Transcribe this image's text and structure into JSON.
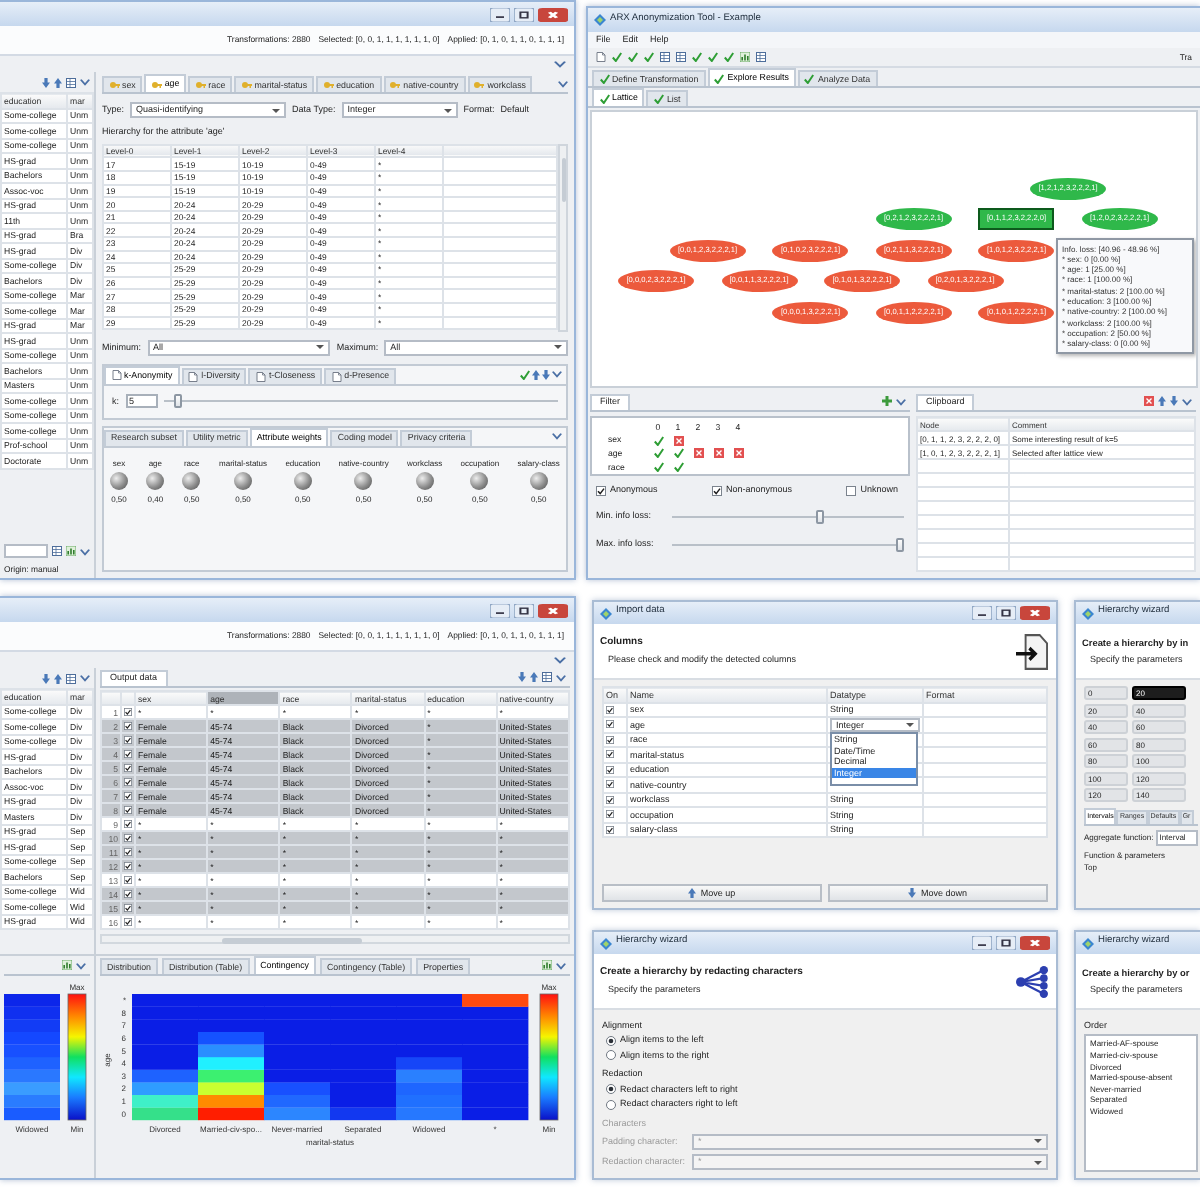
{
  "config_window": {
    "info": [
      "Transformations: 2880",
      "Selected: [0, 0, 1, 1, 1, 1, 1, 1, 0]",
      "Applied: [0, 1, 0, 1, 1, 0, 1, 1, 1]"
    ],
    "input_table": {
      "columns": [
        "education",
        "mar"
      ],
      "rows": [
        [
          "Some-college",
          "Unm"
        ],
        [
          "Some-college",
          "Unm"
        ],
        [
          "Some-college",
          "Unm"
        ],
        [
          "HS-grad",
          "Unm"
        ],
        [
          "Bachelors",
          "Unm"
        ],
        [
          "Assoc-voc",
          "Unm"
        ],
        [
          "HS-grad",
          "Unm"
        ],
        [
          "11th",
          "Unm"
        ],
        [
          "HS-grad",
          "Bra"
        ],
        [
          "HS-grad",
          "Div"
        ],
        [
          "Some-college",
          "Div"
        ],
        [
          "Bachelors",
          "Div"
        ],
        [
          "Some-college",
          "Mar"
        ],
        [
          "Some-college",
          "Mar"
        ],
        [
          "HS-grad",
          "Mar"
        ],
        [
          "HS-grad",
          "Unm"
        ],
        [
          "Some-college",
          "Unm"
        ],
        [
          "Bachelors",
          "Unm"
        ],
        [
          "Masters",
          "Unm"
        ],
        [
          "Some-college",
          "Unm"
        ],
        [
          "Some-college",
          "Unm"
        ],
        [
          "Some-college",
          "Unm"
        ],
        [
          "Prof-school",
          "Unm"
        ],
        [
          "Doctorate",
          "Unm"
        ]
      ]
    },
    "origin": "Origin: manual",
    "attribute_tabs": [
      {
        "label": "sex",
        "selected": false
      },
      {
        "label": "age",
        "selected": true
      },
      {
        "label": "race",
        "selected": false
      },
      {
        "label": "marital-status",
        "selected": false
      },
      {
        "label": "education",
        "selected": false
      },
      {
        "label": "native-country",
        "selected": false
      },
      {
        "label": "workclass",
        "selected": false
      }
    ],
    "type": {
      "label": "Type:",
      "value": "Quasi-identifying"
    },
    "data_type": {
      "label": "Data Type:",
      "value": "Integer"
    },
    "format": {
      "label": "Format:",
      "value": "Default"
    },
    "hierarchy_caption": "Hierarchy for the attribute 'age'",
    "hierarchy": {
      "columns": [
        "Level-0",
        "Level-1",
        "Level-2",
        "Level-3",
        "Level-4"
      ],
      "rows": [
        [
          "17",
          "15-19",
          "10-19",
          "0-49",
          "*"
        ],
        [
          "18",
          "15-19",
          "10-19",
          "0-49",
          "*"
        ],
        [
          "19",
          "15-19",
          "10-19",
          "0-49",
          "*"
        ],
        [
          "20",
          "20-24",
          "20-29",
          "0-49",
          "*"
        ],
        [
          "21",
          "20-24",
          "20-29",
          "0-49",
          "*"
        ],
        [
          "22",
          "20-24",
          "20-29",
          "0-49",
          "*"
        ],
        [
          "23",
          "20-24",
          "20-29",
          "0-49",
          "*"
        ],
        [
          "24",
          "20-24",
          "20-29",
          "0-49",
          "*"
        ],
        [
          "25",
          "25-29",
          "20-29",
          "0-49",
          "*"
        ],
        [
          "26",
          "25-29",
          "20-29",
          "0-49",
          "*"
        ],
        [
          "27",
          "25-29",
          "20-29",
          "0-49",
          "*"
        ],
        [
          "28",
          "25-29",
          "20-29",
          "0-49",
          "*"
        ],
        [
          "29",
          "25-29",
          "20-29",
          "0-49",
          "*"
        ]
      ]
    },
    "minimum": {
      "label": "Minimum:",
      "value": "All"
    },
    "maximum": {
      "label": "Maximum:",
      "value": "All"
    },
    "criteria_tabs": [
      {
        "label": "k-Anonymity",
        "selected": true
      },
      {
        "label": "l-Diversity",
        "selected": false
      },
      {
        "label": "t-Closeness",
        "selected": false
      },
      {
        "label": "d-Presence",
        "selected": false
      }
    ],
    "k": {
      "label": "k:",
      "value": "5",
      "level": 0.03
    },
    "settings_tabs": [
      {
        "label": "Research subset",
        "selected": false
      },
      {
        "label": "Utility metric",
        "selected": false
      },
      {
        "label": "Attribute weights",
        "selected": true
      },
      {
        "label": "Coding model",
        "selected": false
      },
      {
        "label": "Privacy criteria",
        "selected": false
      }
    ],
    "weights": [
      {
        "name": "sex",
        "value": "0,50"
      },
      {
        "name": "age",
        "value": "0,40"
      },
      {
        "name": "race",
        "value": "0,50"
      },
      {
        "name": "marital-status",
        "value": "0,50"
      },
      {
        "name": "education",
        "value": "0,50"
      },
      {
        "name": "native-country",
        "value": "0,50"
      },
      {
        "name": "workclass",
        "value": "0,50"
      },
      {
        "name": "occupation",
        "value": "0,50"
      },
      {
        "name": "salary-class",
        "value": "0,50"
      }
    ]
  },
  "lattice_window": {
    "title": "ARX Anonymization Tool - Example",
    "menu": [
      "File",
      "Edit",
      "Help"
    ],
    "toolbar_info": "Tra",
    "perspectives": [
      {
        "label": "Define Transformation",
        "selected": false
      },
      {
        "label": "Explore Results",
        "selected": true
      },
      {
        "label": "Analyze Data",
        "selected": false
      }
    ],
    "views": [
      {
        "label": "Lattice",
        "selected": true
      },
      {
        "label": "List",
        "selected": false
      }
    ],
    "lattice": {
      "levels": [
        {
          "nodes": [
            {
              "label": "[1,2,1,2,3,2,2,2,1]",
              "anonymous": true,
              "selected": false
            }
          ]
        },
        {
          "nodes": [
            {
              "label": "[0,2,1,2,3,2,2,2,1]",
              "anonymous": true,
              "selected": false
            },
            {
              "label": "[0,1,1,2,3,2,2,2,0]",
              "anonymous": true,
              "selected": true
            },
            {
              "label": "[1,2,0,2,3,2,2,2,1]",
              "anonymous": true,
              "selected": false
            }
          ]
        },
        {
          "nodes": [
            {
              "label": "[0,0,1,2,3,2,2,2,1]",
              "anonymous": false,
              "selected": false
            },
            {
              "label": "[0,1,0,2,3,2,2,2,1]",
              "anonymous": false,
              "selected": false
            },
            {
              "label": "[0,2,1,1,3,2,2,2,1]",
              "anonymous": false,
              "selected": false
            },
            {
              "label": "[1,0,1,2,3,2,2,2,1]",
              "anonymous": false,
              "selected": false
            }
          ]
        },
        {
          "nodes": [
            {
              "label": "[0,0,0,2,3,2,2,2,1]",
              "anonymous": false,
              "selected": false
            },
            {
              "label": "[0,0,1,1,3,2,2,2,1]",
              "anonymous": false,
              "selected": false
            },
            {
              "label": "[0,1,0,1,3,2,2,2,1]",
              "anonymous": false,
              "selected": false
            },
            {
              "label": "[0,2,0,1,3,2,2,2,1]",
              "anonymous": false,
              "selected": false
            }
          ]
        },
        {
          "nodes": [
            {
              "label": "[0,0,0,1,3,2,2,2,1]",
              "anonymous": false,
              "selected": false
            },
            {
              "label": "[0,0,1,1,2,2,2,2,1]",
              "anonymous": false,
              "selected": false
            },
            {
              "label": "[0,1,0,1,2,2,2,2,1]",
              "anonymous": false,
              "selected": false
            }
          ]
        }
      ]
    },
    "tooltip": [
      "Info. loss: [40.96 - 48.96 %]",
      "* sex: 0 [0.00 %]",
      "* age: 1 [25.00 %]",
      "* race: 1 [100.00 %]",
      "* marital-status: 2 [100.00 %]",
      "* education: 3 [100.00 %]",
      "* native-country: 2 [100.00 %]",
      "* workclass: 2 [100.00 %]",
      "* occupation: 2 [50.00 %]",
      "* salary-class: 0 [0.00 %]"
    ],
    "filter": {
      "title": "Filter",
      "levels": [
        "0",
        "1",
        "2",
        "3",
        "4"
      ],
      "rows": [
        {
          "attribute": "sex",
          "levels": [
            true,
            false
          ]
        },
        {
          "attribute": "age",
          "levels": [
            true,
            true,
            false,
            false,
            false
          ]
        },
        {
          "attribute": "race",
          "levels": [
            true,
            true
          ]
        }
      ],
      "checkboxes": [
        {
          "label": "Anonymous",
          "checked": true
        },
        {
          "label": "Non-anonymous",
          "checked": true
        },
        {
          "label": "Unknown",
          "checked": false
        }
      ],
      "sliders": [
        {
          "label": "Min. info loss:",
          "level": 0.64
        },
        {
          "label": "Max. info loss:",
          "level": 1
        }
      ]
    },
    "clipboard": {
      "title": "Clipboard",
      "columns": [
        "Node",
        "Comment"
      ],
      "rows": [
        [
          "[0, 1, 1, 2, 3, 2, 2, 2, 0]",
          "Some interesting result of k=5"
        ],
        [
          "[1, 0, 1, 2, 3, 2, 2, 2, 1]",
          "Selected after lattice view"
        ]
      ]
    }
  },
  "analysis_window": {
    "info": [
      "Transformations: 2880",
      "Selected: [0, 0, 1, 1, 1, 1, 1, 1, 0]",
      "Applied: [0, 1, 0, 1, 1, 0, 1, 1, 1]"
    ],
    "input_table": {
      "columns": [
        "education",
        "mar"
      ],
      "rows": [
        [
          "Some-college",
          "Div"
        ],
        [
          "Some-college",
          "Div"
        ],
        [
          "Some-college",
          "Div"
        ],
        [
          "HS-grad",
          "Div"
        ],
        [
          "Bachelors",
          "Div"
        ],
        [
          "Assoc-voc",
          "Div"
        ],
        [
          "HS-grad",
          "Div"
        ],
        [
          "Masters",
          "Div"
        ],
        [
          "HS-grad",
          "Sep"
        ],
        [
          "HS-grad",
          "Sep"
        ],
        [
          "Some-college",
          "Sep"
        ],
        [
          "Bachelors",
          "Sep"
        ],
        [
          "Some-college",
          "Wid"
        ],
        [
          "Some-college",
          "Wid"
        ],
        [
          "HS-grad",
          "Wid"
        ]
      ]
    },
    "output_title": "Output data",
    "output_table": {
      "columns": [
        {
          "label": "sex",
          "selected": false
        },
        {
          "label": "age",
          "selected": true
        },
        {
          "label": "race",
          "selected": false
        },
        {
          "label": "marital-status",
          "selected": false
        },
        {
          "label": "education",
          "selected": false
        },
        {
          "label": "native-country",
          "selected": false
        }
      ],
      "rows": [
        {
          "number": "1",
          "checked": true,
          "highlighted": false,
          "cells": [
            "*",
            "*",
            "*",
            "*",
            "*",
            "*"
          ]
        },
        {
          "number": "2",
          "checked": true,
          "highlighted": true,
          "cells": [
            "Female",
            "45-74",
            "Black",
            "Divorced",
            "*",
            "United-States"
          ]
        },
        {
          "number": "3",
          "checked": true,
          "highlighted": true,
          "cells": [
            "Female",
            "45-74",
            "Black",
            "Divorced",
            "*",
            "United-States"
          ]
        },
        {
          "number": "4",
          "checked": true,
          "highlighted": true,
          "cells": [
            "Female",
            "45-74",
            "Black",
            "Divorced",
            "*",
            "United-States"
          ]
        },
        {
          "number": "5",
          "checked": true,
          "highlighted": true,
          "cells": [
            "Female",
            "45-74",
            "Black",
            "Divorced",
            "*",
            "United-States"
          ]
        },
        {
          "number": "6",
          "checked": true,
          "highlighted": true,
          "cells": [
            "Female",
            "45-74",
            "Black",
            "Divorced",
            "*",
            "United-States"
          ]
        },
        {
          "number": "7",
          "checked": true,
          "highlighted": true,
          "cells": [
            "Female",
            "45-74",
            "Black",
            "Divorced",
            "*",
            "United-States"
          ]
        },
        {
          "number": "8",
          "checked": true,
          "highlighted": true,
          "cells": [
            "Female",
            "45-74",
            "Black",
            "Divorced",
            "*",
            "United-States"
          ]
        },
        {
          "number": "9",
          "checked": true,
          "highlighted": false,
          "cells": [
            "*",
            "*",
            "*",
            "*",
            "*",
            "*"
          ]
        },
        {
          "number": "10",
          "checked": true,
          "highlighted": true,
          "cells": [
            "*",
            "*",
            "*",
            "*",
            "*",
            "*"
          ]
        },
        {
          "number": "11",
          "checked": true,
          "highlighted": true,
          "cells": [
            "*",
            "*",
            "*",
            "*",
            "*",
            "*"
          ]
        },
        {
          "number": "12",
          "checked": true,
          "highlighted": true,
          "cells": [
            "*",
            "*",
            "*",
            "*",
            "*",
            "*"
          ]
        },
        {
          "number": "13",
          "checked": true,
          "highlighted": false,
          "cells": [
            "*",
            "*",
            "*",
            "*",
            "*",
            "*"
          ]
        },
        {
          "number": "14",
          "checked": true,
          "highlighted": true,
          "cells": [
            "*",
            "*",
            "*",
            "*",
            "*",
            "*"
          ]
        },
        {
          "number": "15",
          "checked": true,
          "highlighted": true,
          "cells": [
            "*",
            "*",
            "*",
            "*",
            "*",
            "*"
          ]
        },
        {
          "number": "16",
          "checked": true,
          "highlighted": false,
          "cells": [
            "*",
            "*",
            "*",
            "*",
            "*",
            "*"
          ]
        }
      ]
    },
    "analysis_tabs": [
      {
        "label": "Distribution",
        "selected": false
      },
      {
        "label": "Distribution (Table)",
        "selected": false
      },
      {
        "label": "Contingency",
        "selected": true
      },
      {
        "label": "Contingency (Table)",
        "selected": false
      },
      {
        "label": "Properties",
        "selected": false
      }
    ],
    "summary_chart": {
      "x_labels": [
        "Widowed"
      ],
      "max_label": "Max",
      "min_label": "Min"
    },
    "contingency_chart": {
      "y_title": "age",
      "y_labels": [
        "*",
        "8",
        "7",
        "6",
        "5",
        "4",
        "3",
        "2",
        "1",
        "0"
      ],
      "x_labels": [
        "Divorced",
        "Married-civ-spo...",
        "Never-married",
        "Separated",
        "Widowed",
        "*"
      ],
      "x_title": "marital-status",
      "max_label": "Max",
      "min_label": "Min"
    }
  },
  "import_dialog": {
    "title": "Import data",
    "heading": "Columns",
    "description": "Please check and modify the detected columns",
    "columns": [
      "On",
      "Name",
      "Datatype",
      "Format"
    ],
    "rows": [
      {
        "checked": true,
        "name": "sex",
        "datatype": "String"
      },
      {
        "checked": true,
        "name": "age",
        "datatype": "Integer",
        "options": [
          {
            "label": "String",
            "selected": false
          },
          {
            "label": "Date/Time",
            "selected": false
          },
          {
            "label": "Decimal",
            "selected": false
          },
          {
            "label": "Integer",
            "selected": true
          }
        ]
      },
      {
        "checked": true,
        "name": "race"
      },
      {
        "checked": true,
        "name": "marital-status"
      },
      {
        "checked": true,
        "name": "education"
      },
      {
        "checked": true,
        "name": "native-country"
      },
      {
        "checked": true,
        "name": "workclass",
        "datatype": "String"
      },
      {
        "checked": true,
        "name": "occupation",
        "datatype": "String"
      },
      {
        "checked": true,
        "name": "salary-class",
        "datatype": "String"
      }
    ],
    "buttons": [
      {
        "label": "Move up",
        "kind": "up"
      },
      {
        "label": "Move down",
        "kind": "down"
      }
    ]
  },
  "redaction_wizard": {
    "title": "Hierarchy wizard",
    "heading": "Create a hierarchy by redacting characters",
    "description": "Specify the parameters",
    "groups": [
      {
        "label": "Alignment",
        "options": [
          {
            "label": "Align items to the left",
            "selected": true
          },
          {
            "label": "Align items to the right",
            "selected": false
          }
        ]
      },
      {
        "label": "Redaction",
        "options": [
          {
            "label": "Redact characters left to right",
            "selected": true
          },
          {
            "label": "Redact characters right to left",
            "selected": false
          }
        ]
      }
    ],
    "characters": {
      "label": "Characters",
      "disabled": true,
      "fields": [
        {
          "label": "Padding character:",
          "value": "*"
        },
        {
          "label": "Redaction character:",
          "value": "*"
        }
      ]
    }
  },
  "interval_wizard": {
    "title": "Hierarchy wizard",
    "heading": "Create a hierarchy by in",
    "description": "Specify the parameters",
    "intervals": [
      {
        "from": "0",
        "to": "20",
        "selected": true
      },
      {
        "from": "20",
        "to": "40",
        "selected": false
      },
      {
        "from": "40",
        "to": "60",
        "selected": false
      },
      {
        "from": "60",
        "to": "80",
        "selected": false
      },
      {
        "from": "80",
        "to": "100",
        "selected": false
      },
      {
        "from": "100",
        "to": "120",
        "selected": false
      },
      {
        "from": "120",
        "to": "140",
        "selected": false
      }
    ],
    "tabs": [
      {
        "label": "Intervals",
        "selected": true
      },
      {
        "label": "Ranges",
        "selected": false
      },
      {
        "label": "Defaults",
        "selected": false
      },
      {
        "label": "Gr",
        "selected": false
      }
    ],
    "aggregate": {
      "label": "Aggregate function:",
      "value": "Interval"
    },
    "parameters_label": "Function & parameters",
    "top_label": "Top"
  },
  "order_wizard": {
    "title": "Hierarchy wizard",
    "heading": "Create a hierarchy by or",
    "description": "Specify the parameters",
    "list_label": "Order",
    "values": [
      "Married-AF-spouse",
      "Married-civ-spouse",
      "Divorced",
      "Married-spouse-absent",
      "Never-married",
      "Separated",
      "Widowed"
    ]
  }
}
